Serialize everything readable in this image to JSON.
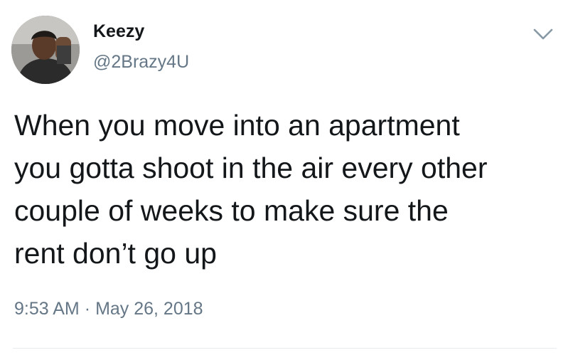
{
  "author": {
    "display_name": "Keezy",
    "handle": "@2Brazy4U",
    "avatar_icon": "user-avatar-photo"
  },
  "menu": {
    "caret_icon": "chevron-down-icon"
  },
  "tweet": {
    "lines": [
      "When you move into an apartment",
      "you gotta shoot in the air every other",
      "couple of weeks to make sure the",
      "rent don’t go up"
    ]
  },
  "timestamp": {
    "time": "9:53 AM",
    "separator": "·",
    "date": "May 26, 2018"
  },
  "colors": {
    "text": "#14171a",
    "secondary_text": "#657786",
    "divider": "#e6ecf0",
    "background": "#ffffff"
  }
}
